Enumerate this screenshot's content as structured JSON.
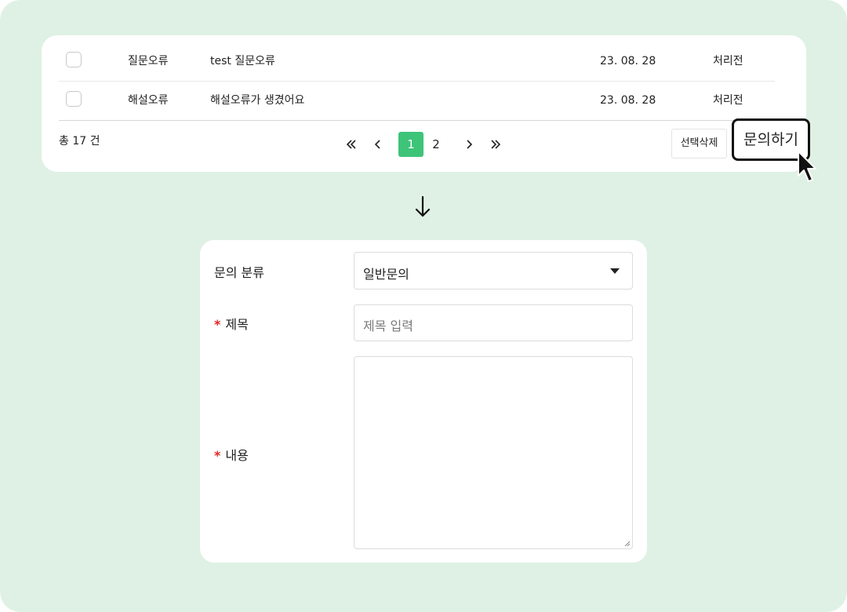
{
  "list": {
    "rows": [
      {
        "category": "질문오류",
        "title": "test 질문오류",
        "date": "23. 08. 28",
        "status": "처리전"
      },
      {
        "category": "해설오류",
        "title": "해설오류가 생겼어요",
        "date": "23. 08. 28",
        "status": "처리전"
      }
    ],
    "total": "총 17 건",
    "pagination": {
      "pages": [
        "1",
        "2"
      ],
      "current": "1"
    },
    "delete_button": "선택삭제",
    "inquire_button": "문의하기"
  },
  "form": {
    "category_label": "문의 분류",
    "category_value": "일반문의",
    "title_label": "제목",
    "title_placeholder": "제목 입력",
    "body_label": "내용",
    "required_mark": "*"
  },
  "colors": {
    "background": "#dff1e4",
    "accent": "#3dc479",
    "required": "#e02424"
  }
}
